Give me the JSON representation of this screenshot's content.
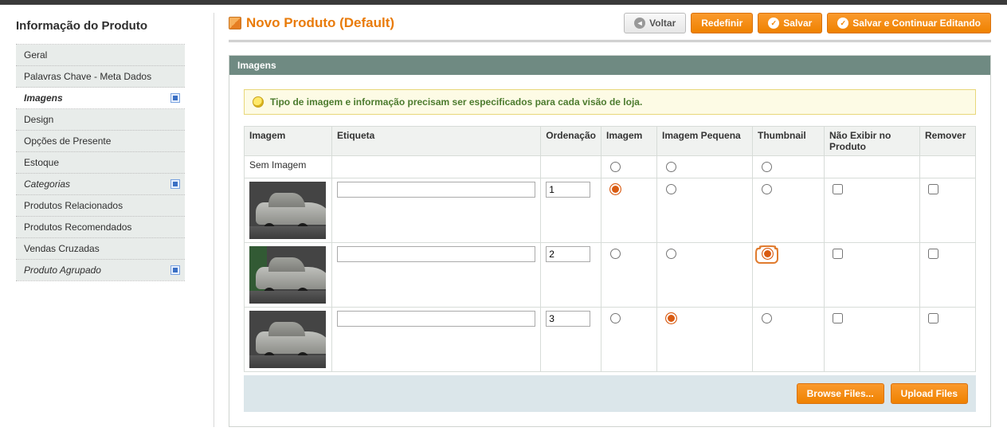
{
  "sidebar": {
    "title": "Informação do Produto",
    "items": [
      {
        "label": "Geral"
      },
      {
        "label": "Palavras Chave - Meta Dados"
      },
      {
        "label": "Imagens"
      },
      {
        "label": "Design"
      },
      {
        "label": "Opções de Presente"
      },
      {
        "label": "Estoque"
      },
      {
        "label": "Categorias"
      },
      {
        "label": "Produtos Relacionados"
      },
      {
        "label": "Produtos Recomendados"
      },
      {
        "label": "Vendas Cruzadas"
      },
      {
        "label": "Produto Agrupado"
      }
    ]
  },
  "header": {
    "title": "Novo Produto (Default)",
    "buttons": {
      "back": "Voltar",
      "reset": "Redefinir",
      "save": "Salvar",
      "save_continue": "Salvar e Continuar Editando"
    }
  },
  "section": {
    "title": "Imagens",
    "notice": "Tipo de imagem e informação precisam ser especificados para cada visão de loja."
  },
  "table": {
    "headers": {
      "image": "Imagem",
      "label": "Etiqueta",
      "order": "Ordenação",
      "radio_image": "Imagem",
      "small_image": "Imagem Pequena",
      "thumbnail": "Thumbnail",
      "exclude": "Não Exibir no Produto",
      "remove": "Remover"
    },
    "no_image_label": "Sem Imagem",
    "rows": [
      {
        "order": "1",
        "image": true,
        "small": false,
        "thumb": false
      },
      {
        "order": "2",
        "image": false,
        "small": false,
        "thumb": true
      },
      {
        "order": "3",
        "image": false,
        "small": true,
        "thumb": false
      }
    ]
  },
  "footer": {
    "browse": "Browse Files...",
    "upload": "Upload Files"
  }
}
